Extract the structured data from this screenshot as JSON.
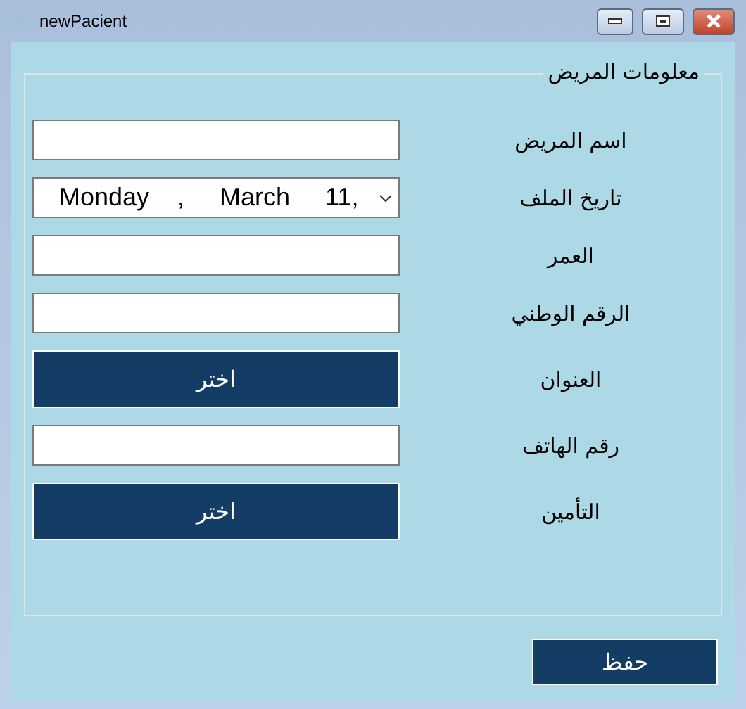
{
  "window": {
    "title": "newPacient"
  },
  "group": {
    "title": "معلومات المريض"
  },
  "fields": [
    {
      "kind": "text",
      "label": "اسم المريض"
    },
    {
      "kind": "date",
      "label": "تاريخ الملف",
      "value": "Monday    ,     March     11,"
    },
    {
      "kind": "text",
      "label": "العمر"
    },
    {
      "kind": "text",
      "label": "الرقم الوطني"
    },
    {
      "kind": "choose",
      "label": "العنوان",
      "button": "اختر"
    },
    {
      "kind": "text",
      "label": "رقم الهاتف"
    },
    {
      "kind": "choose",
      "label": "التأمين",
      "button": "اختر"
    }
  ],
  "save_button": "حفظ"
}
